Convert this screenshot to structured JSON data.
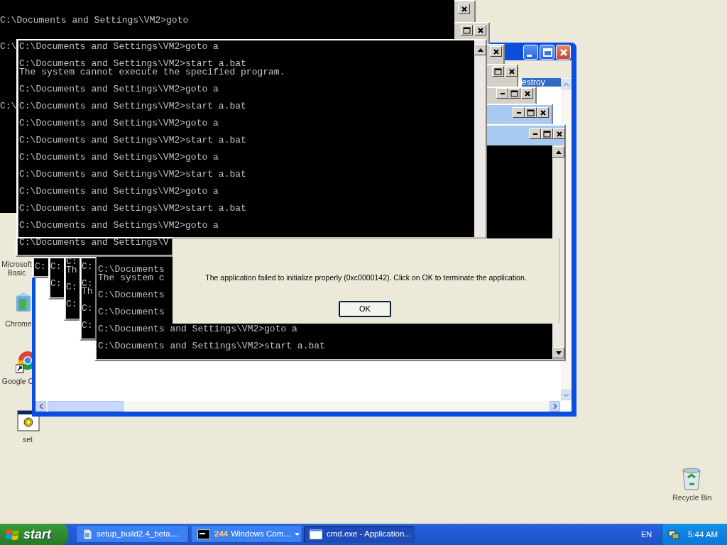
{
  "desktop_icons": [
    {
      "label": "Microsoft Basic",
      "kind": "covered"
    },
    {
      "label": "Chrome",
      "kind": "installer"
    },
    {
      "label": "Google C",
      "kind": "browser"
    },
    {
      "label": "set",
      "kind": "setup"
    },
    {
      "label": "Recycle Bin",
      "kind": "recycle"
    }
  ],
  "explorer_window": {
    "list_item": {
      "text": "estroy",
      "selected": true
    }
  },
  "console_windows": [
    {
      "lines": [
        "C:\\Documents and Settings\\VM2>goto",
        "C:\\",
        "C:\\"
      ]
    },
    {
      "lines": [
        "C:\\Documents and Settings\\VM2>goto a",
        "C:\\Documents and Settings\\VM2>start a.bat",
        "The system cannot execute the specified program.",
        "C:\\Documents and Settings\\VM2>goto a",
        "C:\\Documents and Settings\\VM2>start a.bat",
        "C:\\Documents and Settings\\VM2>goto a",
        "C:\\Documents and Settings\\VM2>start a.bat",
        "C:\\Documents and Settings\\VM2>goto a",
        "C:\\Documents and Settings\\VM2>start a.bat",
        "C:\\Documents and Settings\\VM2>goto a",
        "C:\\Documents and Settings\\VM2>start a.bat",
        "C:\\Documents and Settings\\VM2>goto a"
      ]
    },
    {
      "lines": [
        "C:\\Documents and Settings\\V"
      ]
    },
    {
      "lines": [
        "C:"
      ]
    },
    {
      "lines": [
        "C:",
        "C:"
      ]
    },
    {
      "lines": [
        "C:",
        "Th",
        "C:",
        "C:"
      ]
    },
    {
      "lines": [
        "C:",
        "C:",
        "Th",
        "C:",
        "C:"
      ]
    },
    {
      "lines": [
        "C:\\Documents",
        "The system c",
        "C:\\Documents",
        "C:\\Documents",
        "C:\\Documents and Settings\\VM2>goto a",
        "C:\\Documents and Settings\\VM2>start a.bat"
      ]
    }
  ],
  "dialog": {
    "message": "The application failed to initialize properly (0xc0000142). Click on OK to terminate the application.",
    "button": "OK"
  },
  "taskbar": {
    "start": "start",
    "tasks": [
      {
        "label": "setup_build2.4_beta....",
        "kind": "installer",
        "selected": false
      },
      {
        "label": "Windows Com...",
        "count": "244",
        "kind": "console",
        "selected": false
      },
      {
        "label": "cmd.exe - Application...",
        "kind": "window",
        "selected": true
      }
    ],
    "language": "EN",
    "clock": "5:44 AM"
  }
}
